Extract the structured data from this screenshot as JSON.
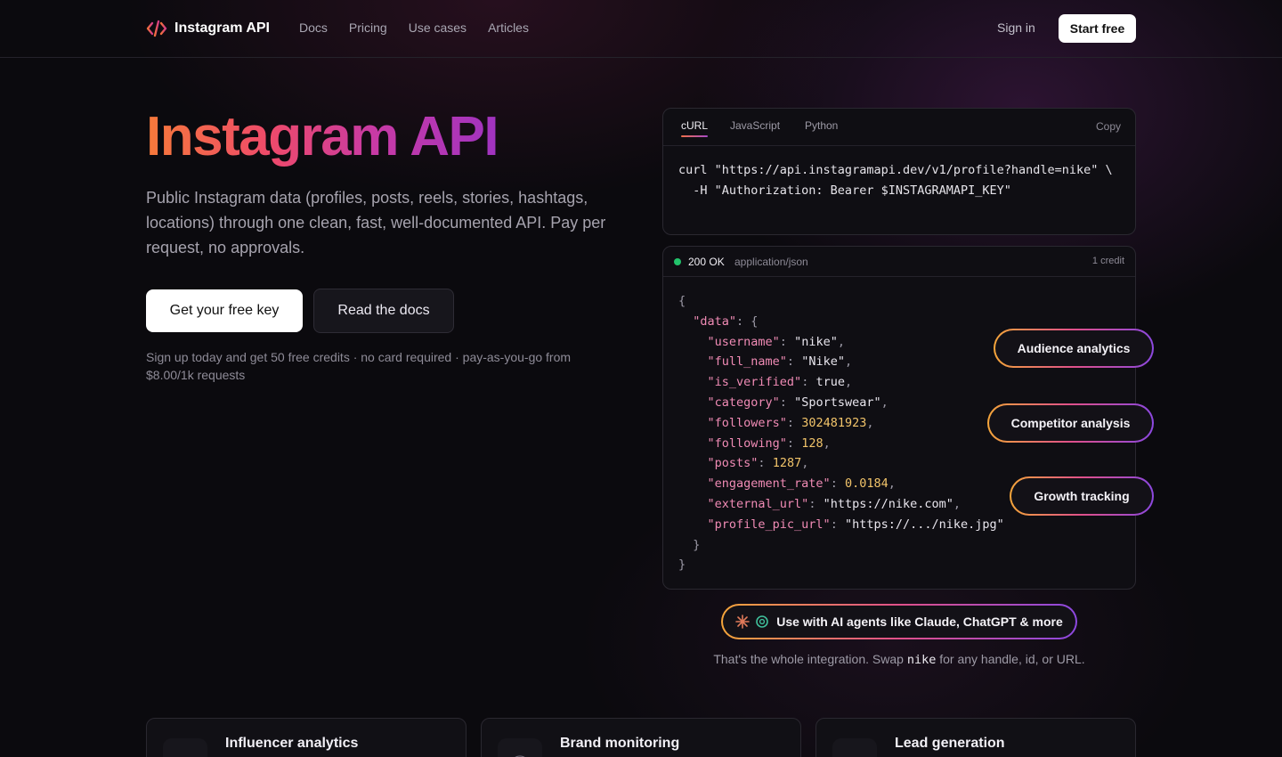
{
  "nav": {
    "logo_text": "Instagram API",
    "links": [
      "Docs",
      "Pricing",
      "Use cases",
      "Articles"
    ],
    "sign_in": "Sign in",
    "start_free": "Start free"
  },
  "hero": {
    "title": "Instagram API",
    "subtitle": "Public Instagram data (profiles, posts, reels, stories, hashtags, locations) through one clean, fast, well-documented API. Pay per request, no approvals.",
    "primary_button": "Get your free key",
    "secondary_button": "Read the docs",
    "signup_note": "Sign up today and get 50 free credits · no card required · pay-as-you-go from $8.00/1k requests"
  },
  "code_panel": {
    "tabs": [
      "cURL",
      "JavaScript",
      "Python"
    ],
    "active_tab": "cURL",
    "copy_label": "Copy",
    "line1": "curl \"https://api.instagramapi.dev/v1/profile?handle=nike\" \\",
    "line2": "  -H \"Authorization: Bearer $INSTAGRAMAPI_KEY\""
  },
  "response": {
    "status_code": "200 OK",
    "content_type": "application/json",
    "credit": "1 credit",
    "status_color": "#22c36b",
    "data_key": "\"data\"",
    "fields": [
      {
        "key": "\"username\"",
        "value": "\"nike\"",
        "kind": "s"
      },
      {
        "key": "\"full_name\"",
        "value": "\"Nike\"",
        "kind": "s"
      },
      {
        "key": "\"is_verified\"",
        "value": "true",
        "kind": "b"
      },
      {
        "key": "\"category\"",
        "value": "\"Sportswear\"",
        "kind": "s"
      },
      {
        "key": "\"followers\"",
        "value": "302481923",
        "kind": "n"
      },
      {
        "key": "\"following\"",
        "value": "128",
        "kind": "n"
      },
      {
        "key": "\"posts\"",
        "value": "1287",
        "kind": "n"
      },
      {
        "key": "\"engagement_rate\"",
        "value": "0.0184",
        "kind": "n"
      },
      {
        "key": "\"external_url\"",
        "value": "\"https://nike.com\"",
        "kind": "s"
      },
      {
        "key": "\"profile_pic_url\"",
        "value": "\"https://.../nike.jpg\"",
        "kind": "s"
      }
    ]
  },
  "pills": {
    "audience": "Audience analytics",
    "competitor": "Competitor analysis",
    "growth": "Growth tracking"
  },
  "ai": {
    "label": "Use with AI agents like Claude, ChatGPT & more",
    "note_before": "That's the whole integration. Swap ",
    "note_code": "nike",
    "note_after": " for any handle, id, or URL."
  },
  "cards": [
    {
      "title": "Influencer analytics",
      "icon": "search-icon"
    },
    {
      "title": "Brand monitoring",
      "icon": "radar-icon"
    },
    {
      "title": "Lead generation",
      "icon": "target-icon"
    }
  ]
}
